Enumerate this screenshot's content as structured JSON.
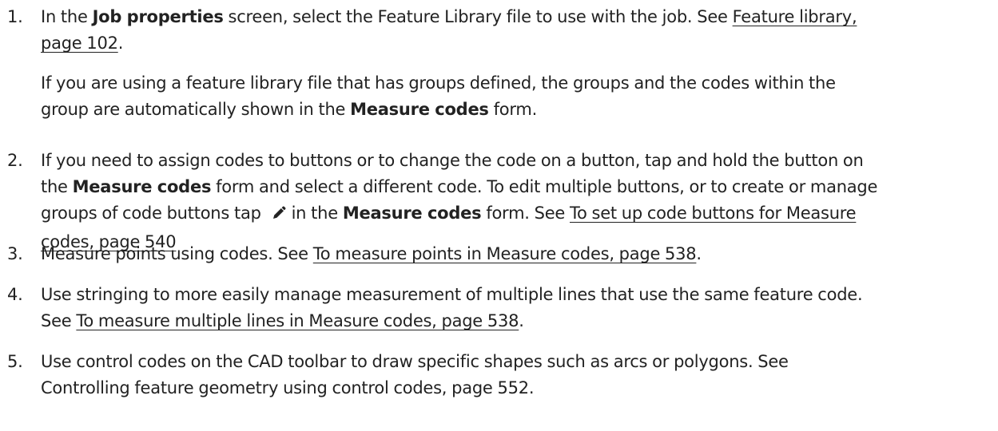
{
  "steps": [
    {
      "number": "1.",
      "l1_pre": "In the ",
      "l1_bold": "Job properties",
      "l1_post": " screen, select the Feature Library file to use with the job. See ",
      "link_line1": "Feature library,",
      "link_line2": "page 102",
      "l2_post": ".",
      "extra_l1": "If you are using a feature library file that has groups defined, the groups and the codes within the",
      "extra_l2_pre": "group are automatically shown in the ",
      "extra_l2_bold": "Measure codes",
      "extra_l2_post": " form."
    },
    {
      "number": "2.",
      "l1": "If you need to assign codes to buttons or to change the code on a button, tap and hold the button on",
      "l2_pre": "the ",
      "l2_bold": "Measure codes",
      "l2_post": " form and select a different code. To edit multiple buttons, or to create or manage",
      "l3_pre": "groups of code buttons tap ",
      "l3_mid": "in the ",
      "l3_bold": "Measure codes",
      "l3_post": " form. See ",
      "link_line1": "To set up code buttons for Measure",
      "link_line2": "codes, page 540"
    },
    {
      "number": "3.",
      "text_pre": "Measure points using codes. See ",
      "link": "To measure points in Measure codes, page 538",
      "text_post": "."
    },
    {
      "number": "4.",
      "l1": "Use stringing to more easily manage measurement of multiple lines that use the same feature code.",
      "l2_pre": "See ",
      "link": "To measure multiple lines in Measure codes, page 538",
      "l2_post": "."
    },
    {
      "number": "5.",
      "l1": "Use control codes on the CAD toolbar to draw specific shapes such as arcs or polygons. See",
      "l2": "Controlling feature geometry using control codes, page 552."
    }
  ],
  "icons": {
    "edit": "pencil-icon"
  },
  "colors": {
    "text": "#222222",
    "background": "#ffffff"
  }
}
